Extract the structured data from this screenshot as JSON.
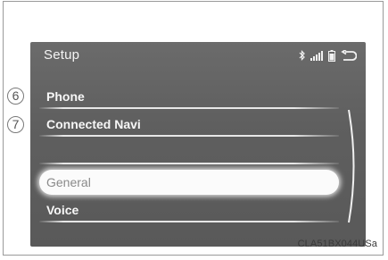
{
  "header": {
    "title": "Setup",
    "status_icons": [
      "bluetooth-icon",
      "signal-strength-icon",
      "battery-icon",
      "back-arrow-icon"
    ]
  },
  "menu": {
    "items": [
      {
        "label": "Phone",
        "callout": "6",
        "selected": false
      },
      {
        "label": "Connected Navi",
        "callout": "7",
        "selected": false
      },
      {
        "label": "",
        "selected": false
      },
      {
        "label": "General",
        "selected": true
      },
      {
        "label": "Voice",
        "selected": false
      }
    ]
  },
  "footer": {
    "caption": "CLA51BX044USa"
  },
  "colors": {
    "screen_bg": "#606060",
    "text": "#f7f7f7",
    "selected_bg": "#fbfbfb",
    "selected_text": "#8a8a8a"
  }
}
